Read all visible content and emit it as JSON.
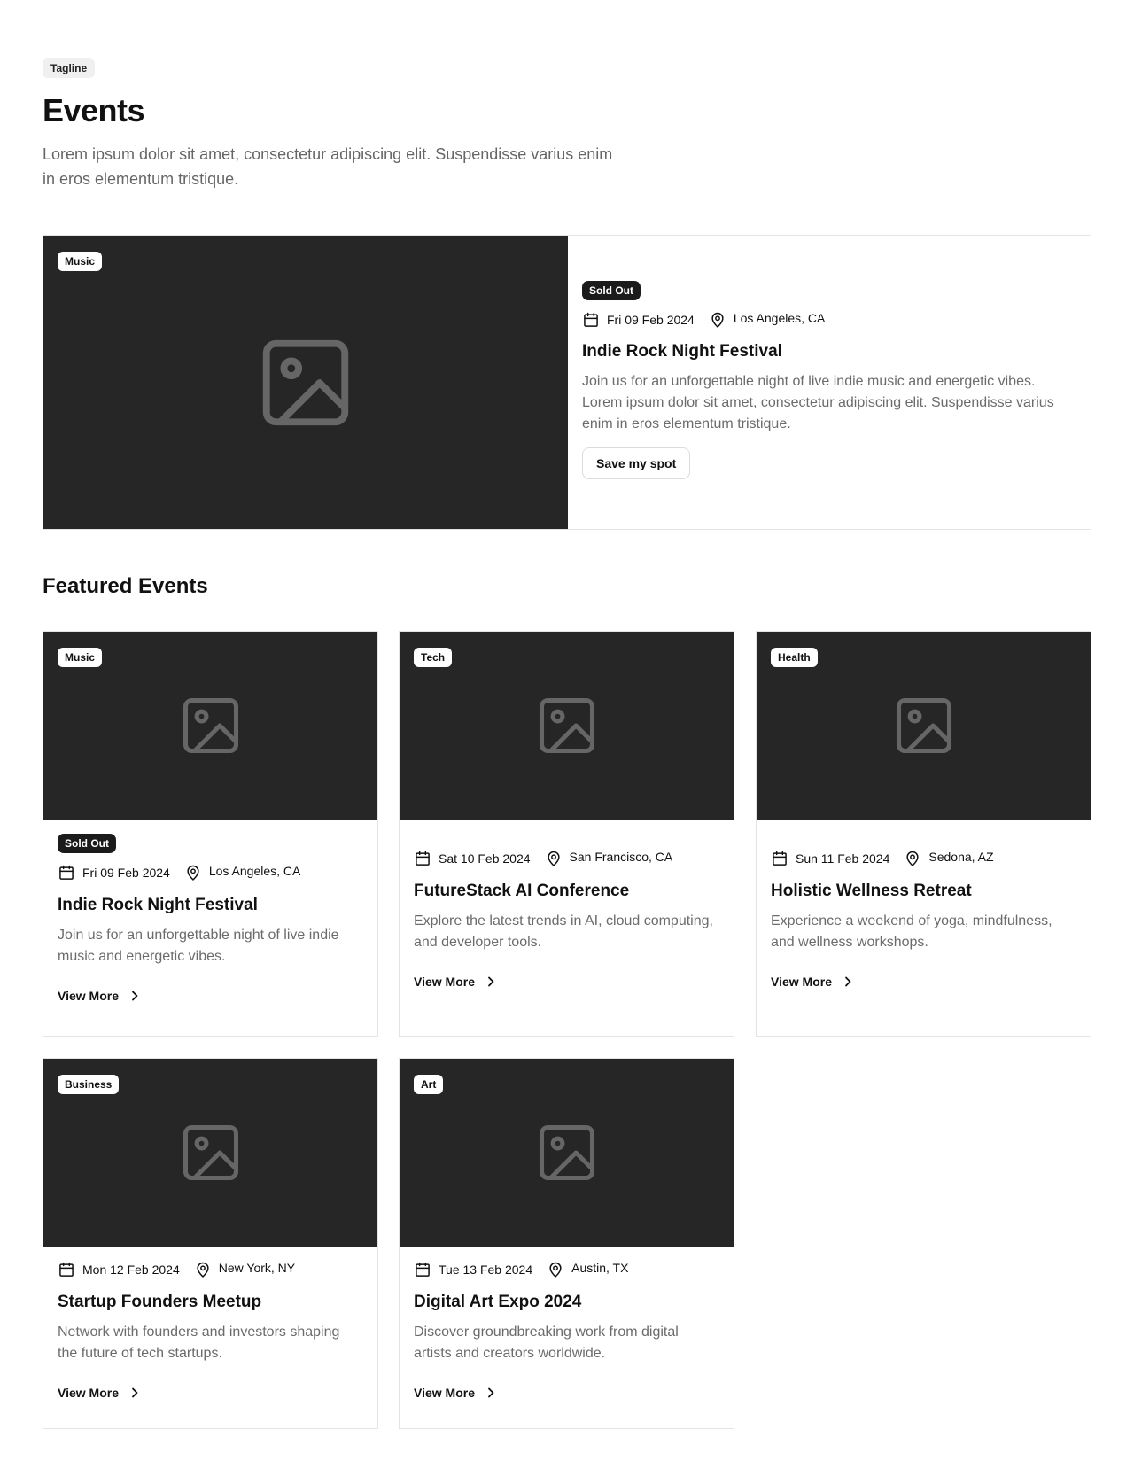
{
  "header": {
    "tagline": "Tagline",
    "title": "Events",
    "description": "Lorem ipsum dolor sit amet, consectetur adipiscing elit. Suspendisse varius enim in eros elementum tristique."
  },
  "hero": {
    "category": "Music",
    "status": "Sold Out",
    "date": "Fri 09 Feb 2024",
    "location": "Los Angeles, CA",
    "title": "Indie Rock Night Festival",
    "description": "Join us for an unforgettable night of live indie music and energetic vibes. Lorem ipsum dolor sit amet, consectetur adipiscing elit. Suspendisse varius enim in eros elementum tristique.",
    "button_label": "Save my spot"
  },
  "featured": {
    "title": "Featured Events",
    "view_more_label": "View More",
    "cards": [
      {
        "category": "Music",
        "status": "Sold Out",
        "date": "Fri 09 Feb 2024",
        "location": "Los Angeles, CA",
        "title": "Indie Rock Night Festival",
        "description": "Join us for an unforgettable night of live indie music and energetic vibes."
      },
      {
        "category": "Tech",
        "date": "Sat 10 Feb 2024",
        "location": "San Francisco, CA",
        "title": "FutureStack AI Conference",
        "description": "Explore the latest trends in AI, cloud computing, and developer tools."
      },
      {
        "category": "Health",
        "date": "Sun 11 Feb 2024",
        "location": "Sedona, AZ",
        "title": "Holistic Wellness Retreat",
        "description": "Experience a weekend of yoga, mindfulness, and wellness workshops."
      },
      {
        "category": "Business",
        "date": "Mon 12 Feb 2024",
        "location": "New York, NY",
        "title": "Startup Founders Meetup",
        "description": "Network with founders and investors shaping the future of tech startups."
      },
      {
        "category": "Art",
        "date": "Tue 13 Feb 2024",
        "location": "Austin, TX",
        "title": "Digital Art Expo 2024",
        "description": "Discover groundbreaking work from digital artists and creators worldwide."
      }
    ]
  },
  "icons": {
    "image_placeholder": "image-placeholder-icon",
    "date": "calendar-icon",
    "location": "map-pin-icon",
    "view_more": "chevron-right-icon"
  },
  "colors": {
    "image_background": "#262626",
    "placeholder_icon": "#666666",
    "badge_dark": "#1b1b1b",
    "text_muted": "#6b6b6b"
  }
}
